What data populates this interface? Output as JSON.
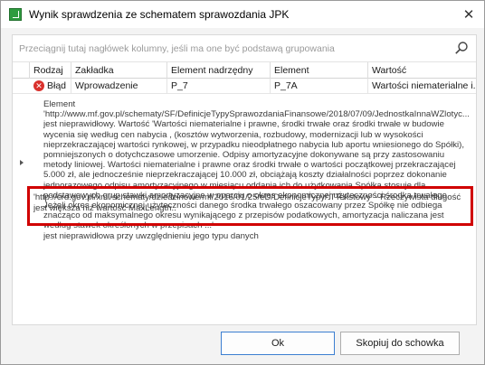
{
  "window": {
    "title": "Wynik sprawdzenia ze schematem sprawozdania JPK",
    "close_glyph": "✕"
  },
  "grid": {
    "group_placeholder": "Przeciągnij tutaj nagłówek kolumny, jeśli ma one być podstawą grupowania",
    "columns": [
      "Rodzaj",
      "Zakładka",
      "Element nadrzędny",
      "Element",
      "Wartość"
    ],
    "rows": [
      {
        "rodzaj": "Błąd",
        "zakladka": "Wprowadzenie",
        "element_nadrzedny": "P_7",
        "element": "P_7A",
        "wartosc": "Wartości niematerialne i..."
      }
    ]
  },
  "detail": {
    "text": "Element\n'http://www.mf.gov.pl/schematy/SF/DefinicjeTypySprawozdaniaFinansowe/2018/07/09/JednostkaInnaWZlotyc...\njest nieprawidłowy. Wartość 'Wartości niematerialne i prawne, środki trwałe oraz środki trwałe w budowie wycenia się według cen nabycia , (kosztów wytworzenia, rozbudowy, modernizacji lub w wysokości nieprzekraczającej wartości rynkowej, w przypadku nieodpłatnego nabycia lub aportu wniesionego do Spółki), pomniejszonych o dotychczasowe umorzenie. Odpisy amortyzacyjne dokonywane są przy zastosowaniu metody liniowej. Wartości niematerialne i prawne oraz środki trwałe o wartości początkowej przekraczającej 5.000 zł, ale jednocześnie nieprzekraczającej 10.000 zł, obciążają koszty działalności poprzez dokonanie jednorazowego odpisu amortyzacyjnego w miesiącu oddania ich do użytkowania Spółka stosuje dla podstawowych grup stawki amortyzacyjne w oparciu o okres ekonomicznej użyteczności środka trwałego. Jeżeli okres ekonomicznej użyteczności danego środka trwałego oszacowany przez Spółkę nie odbiega znacząco od maksymalnego okresu wynikającego z przepisów podatkowych, amortyzacja naliczana jest według stawek określonych w przepisach ...'\njest nieprawidłowa przy uwzględnieniu jego typu danych",
    "highlighted": "'http://crd.gov.pl/xml/schematy/dziedzinowe/mf/2016/01/25/eD/DefinicjeTypy/:TTekstowy' - Rzeczywista długość jest większa niż wartość MaxLength.."
  },
  "buttons": {
    "ok": "Ok",
    "copy": "Skopiuj do schowka"
  },
  "colors": {
    "error": "#d9302c",
    "highlight_border": "#d00000",
    "app_icon": "#2e9c3f"
  }
}
